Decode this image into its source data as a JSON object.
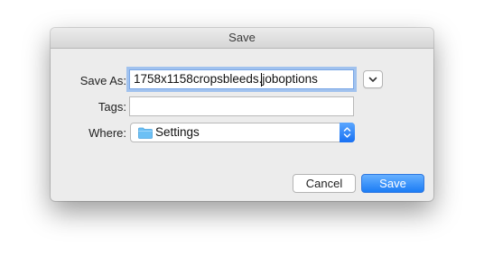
{
  "window": {
    "title": "Save"
  },
  "form": {
    "save_as_label": "Save As:",
    "save_as_value": "1758x1158cropsbleeds.joboptions",
    "tags_label": "Tags:",
    "tags_value": "",
    "where_label": "Where:",
    "where_value": "Settings"
  },
  "buttons": {
    "cancel": "Cancel",
    "save": "Save"
  },
  "icons": {
    "expand": "chevron-down-icon",
    "folder": "folder-icon",
    "popup": "up-down-arrows-icon"
  },
  "colors": {
    "accent": "#1b7cf5",
    "folder": "#6cc0f5",
    "dialog_bg": "#ececec"
  }
}
